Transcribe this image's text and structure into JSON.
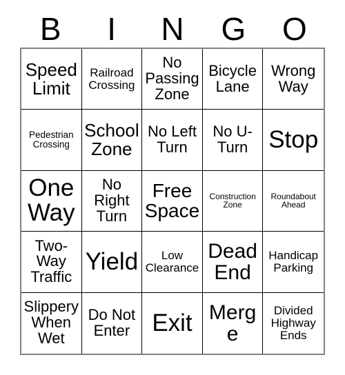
{
  "card": {
    "header_letters": [
      "B",
      "I",
      "N",
      "G",
      "O"
    ],
    "free_space_label": "Free Space",
    "colors": {
      "background": "#ffffff",
      "text": "#000000",
      "inner_border": "#000000",
      "outer_border": "#808080"
    },
    "grid": {
      "rows": 5,
      "columns": 5,
      "cells": [
        [
          {
            "label": "Speed Limit",
            "size": "lg"
          },
          {
            "label": "Railroad Crossing",
            "size": "sm"
          },
          {
            "label": "No Passing Zone",
            "size": "md"
          },
          {
            "label": "Bicycle Lane",
            "size": "md"
          },
          {
            "label": "Wrong Way",
            "size": "md"
          }
        ],
        [
          {
            "label": "Pedestrian Crossing",
            "size": "xs"
          },
          {
            "label": "School Zone",
            "size": "lg"
          },
          {
            "label": "No Left Turn",
            "size": "md"
          },
          {
            "label": "No U-Turn",
            "size": "md"
          },
          {
            "label": "Stop",
            "size": "xxl"
          }
        ],
        [
          {
            "label": "One Way",
            "size": "xxl"
          },
          {
            "label": "No Right Turn",
            "size": "md"
          },
          {
            "label": "Free Space",
            "size": "xl"
          },
          {
            "label": "Construction Zone",
            "size": "xxs"
          },
          {
            "label": "Roundabout Ahead",
            "size": "xxs"
          }
        ],
        [
          {
            "label": "Two-Way Traffic",
            "size": "md"
          },
          {
            "label": "Yield",
            "size": "xxl"
          },
          {
            "label": "Low Clearance",
            "size": "sm"
          },
          {
            "label": "Dead End",
            "size": "xl"
          },
          {
            "label": "Handicap Parking",
            "size": "sm"
          }
        ],
        [
          {
            "label": "Slippery When Wet",
            "size": "md"
          },
          {
            "label": "Do Not Enter",
            "size": "md"
          },
          {
            "label": "Exit",
            "size": "xxl"
          },
          {
            "label": "Merge",
            "size": "xl"
          },
          {
            "label": "Divided Highway Ends",
            "size": "sm"
          }
        ]
      ]
    }
  }
}
